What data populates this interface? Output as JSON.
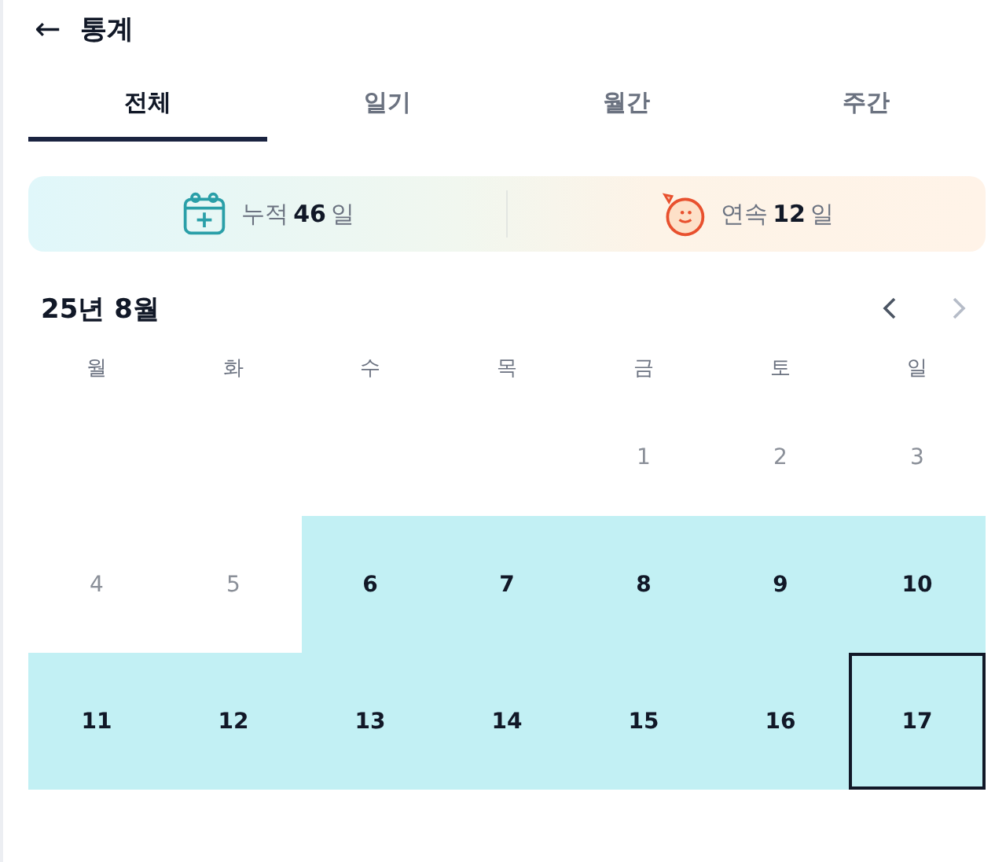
{
  "header": {
    "back": "←",
    "title": "통계"
  },
  "tabs": [
    {
      "label": "전체",
      "selected": true
    },
    {
      "label": "일기",
      "selected": false
    },
    {
      "label": "월간",
      "selected": false
    },
    {
      "label": "주간",
      "selected": false
    }
  ],
  "stats": [
    {
      "kind": "total",
      "label": "누적",
      "value": "46",
      "unit": "일"
    },
    {
      "kind": "streak",
      "label": "연속",
      "value": "12",
      "unit": "일"
    }
  ],
  "calendar": {
    "month": "25년 8월",
    "prev_disabled": false,
    "next_disabled": true,
    "weekdays": [
      "월",
      "화",
      "수",
      "목",
      "금",
      "토",
      "일"
    ],
    "weeks": [
      [
        {
          "kind": "blank"
        },
        {
          "kind": "blank"
        },
        {
          "kind": "blank"
        },
        {
          "kind": "blank"
        },
        {
          "kind": "day",
          "label": "1",
          "recorded": false,
          "selected": false
        },
        {
          "kind": "day",
          "label": "2",
          "recorded": false,
          "selected": false
        },
        {
          "kind": "day",
          "label": "3",
          "recorded": false,
          "selected": false
        }
      ],
      [
        {
          "kind": "day",
          "label": "4",
          "recorded": false,
          "selected": false
        },
        {
          "kind": "day",
          "label": "5",
          "recorded": false,
          "selected": false
        },
        {
          "kind": "day",
          "label": "6",
          "recorded": true,
          "selected": false
        },
        {
          "kind": "day",
          "label": "7",
          "recorded": true,
          "selected": false
        },
        {
          "kind": "day",
          "label": "8",
          "recorded": true,
          "selected": false
        },
        {
          "kind": "day",
          "label": "9",
          "recorded": true,
          "selected": false
        },
        {
          "kind": "day",
          "label": "10",
          "recorded": true,
          "selected": false
        }
      ],
      [
        {
          "kind": "day",
          "label": "11",
          "recorded": true,
          "selected": false
        },
        {
          "kind": "day",
          "label": "12",
          "recorded": true,
          "selected": false
        },
        {
          "kind": "day",
          "label": "13",
          "recorded": true,
          "selected": false
        },
        {
          "kind": "day",
          "label": "14",
          "recorded": true,
          "selected": false
        },
        {
          "kind": "day",
          "label": "15",
          "recorded": true,
          "selected": false
        },
        {
          "kind": "day",
          "label": "16",
          "recorded": true,
          "selected": false
        },
        {
          "kind": "day",
          "label": "17",
          "recorded": true,
          "selected": true
        }
      ]
    ]
  }
}
